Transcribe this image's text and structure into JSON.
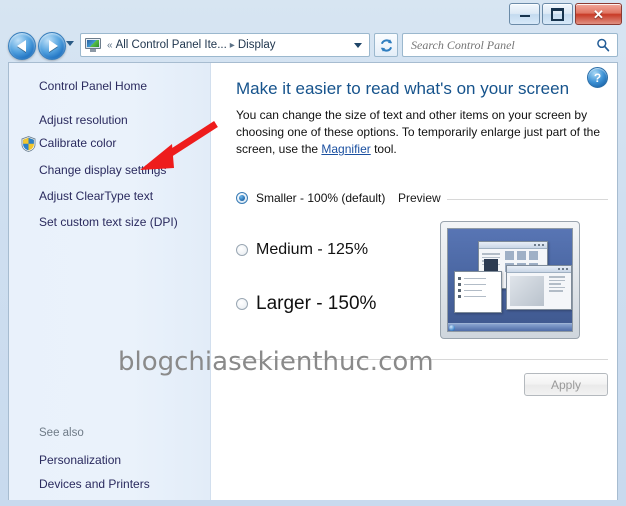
{
  "window": {
    "controls": {
      "minimize": "minimize",
      "maximize": "maximize",
      "close": "✕"
    }
  },
  "navbar": {
    "back_tooltip": "Back",
    "forward_tooltip": "Forward",
    "breadcrumb": {
      "prefix": "«",
      "items": [
        "All Control Panel Ite...",
        "Display"
      ],
      "separator": "▸"
    },
    "refresh_label": "Refresh",
    "search": {
      "placeholder": "Search Control Panel",
      "value": ""
    }
  },
  "sidebar": {
    "home_label": "Control Panel Home",
    "tasks": [
      {
        "label": "Adjust resolution",
        "shield": false
      },
      {
        "label": "Calibrate color",
        "shield": true
      },
      {
        "label": "Change display settings",
        "shield": false
      },
      {
        "label": "Adjust ClearType text",
        "shield": false
      },
      {
        "label": "Set custom text size (DPI)",
        "shield": false
      }
    ],
    "see_also_heading": "See also",
    "see_also": [
      {
        "label": "Personalization"
      },
      {
        "label": "Devices and Printers"
      }
    ]
  },
  "content": {
    "help_label": "?",
    "title": "Make it easier to read what's on your screen",
    "description_part1": "You can change the size of text and other items on your screen by choosing one of these options. To temporarily enlarge just part of the screen, use the ",
    "description_link": "Magnifier",
    "description_part2": " tool.",
    "scale_options": [
      {
        "label": "Smaller - 100% (default)",
        "selected": true,
        "font_size": "12px"
      },
      {
        "label": "Medium - 125%",
        "selected": false,
        "font_size": "16px"
      },
      {
        "label": "Larger - 150%",
        "selected": false,
        "font_size": "19px"
      }
    ],
    "preview_label": "Preview",
    "apply_label": "Apply",
    "apply_enabled": false
  },
  "overlay": {
    "watermark": "blogchiasekienthuc.com",
    "arrow_color": "#ee1c1c",
    "arrow_target": "Change display settings"
  },
  "colors": {
    "accent_title": "#16538c",
    "link": "#2a2a5e",
    "sidebar_bg": "#e9f1fb",
    "annotation": "#ee1c1c"
  }
}
